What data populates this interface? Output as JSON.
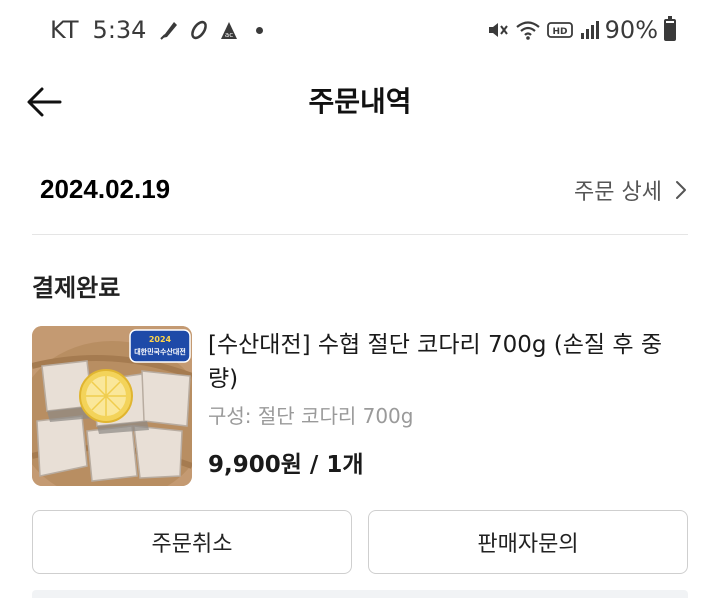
{
  "status_bar": {
    "carrier": "KT",
    "time": "5:34",
    "battery": "90%",
    "battery_level": 0.9,
    "left_icons": [
      "quill-icon",
      "link-icon",
      "ac-icon"
    ],
    "right_icons": [
      "mute-icon",
      "wifi-icon",
      "hd-icon",
      "signal-icon",
      "battery-icon"
    ]
  },
  "header": {
    "title": "주문내역"
  },
  "order": {
    "date": "2024.02.19",
    "detail_link": "주문 상세",
    "status": "결제완료"
  },
  "product": {
    "name": "[수산대전] 수협 절단 코다리 700g (손질 후 중량)",
    "option": "구성: 절단 코다리 700g",
    "price": "9,900원 / 1개",
    "image_badge": "2024 대한민국수산대전"
  },
  "buttons": {
    "cancel": "주문취소",
    "inquiry": "판매자문의"
  },
  "colors": {
    "text_primary": "#111111",
    "text_secondary": "#555555",
    "text_muted": "#9a9a9a",
    "border": "#cfcfcf"
  }
}
